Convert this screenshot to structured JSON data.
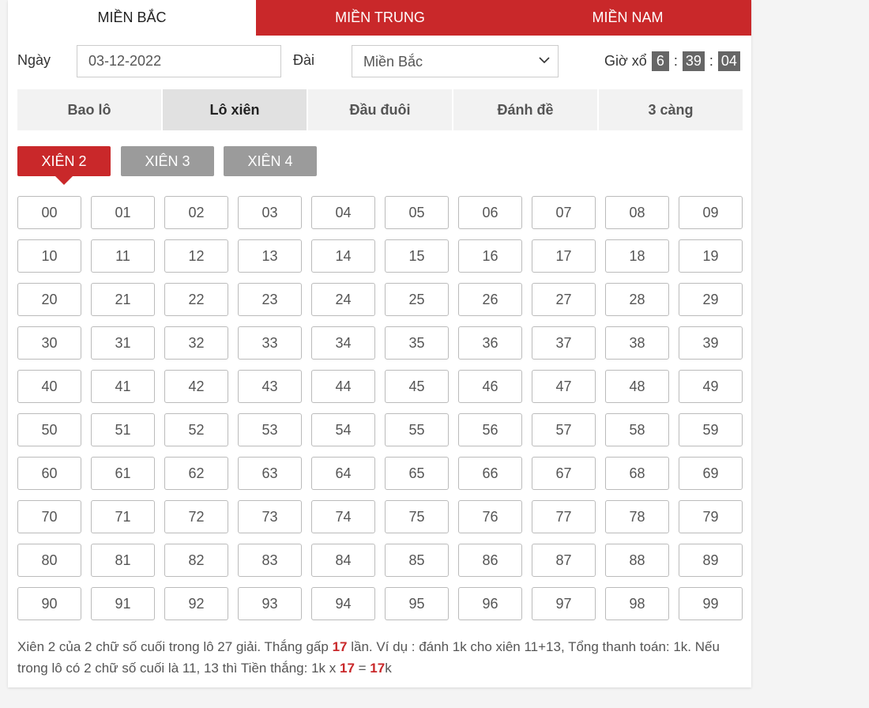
{
  "region_tabs": [
    {
      "label": "MIỀN BẮC",
      "active": true
    },
    {
      "label": "MIỀN TRUNG",
      "active": false
    },
    {
      "label": "MIỀN NAM",
      "active": false
    }
  ],
  "form": {
    "date_label": "Ngày",
    "date_value": "03-12-2022",
    "station_label": "Đài",
    "station_value": "Miền Bắc",
    "draw_time_label": "Giờ xổ",
    "hour": "6",
    "minute": "39",
    "second": "04",
    "separator": ":"
  },
  "game_tabs": [
    {
      "label": "Bao lô",
      "active": false
    },
    {
      "label": "Lô xiên",
      "active": true
    },
    {
      "label": "Đầu đuôi",
      "active": false
    },
    {
      "label": "Đánh đề",
      "active": false
    },
    {
      "label": "3 càng",
      "active": false
    }
  ],
  "xien_buttons": [
    {
      "label": "XIÊN 2",
      "active": true
    },
    {
      "label": "XIÊN 3",
      "active": false
    },
    {
      "label": "XIÊN 4",
      "active": false
    }
  ],
  "numbers": [
    "00",
    "01",
    "02",
    "03",
    "04",
    "05",
    "06",
    "07",
    "08",
    "09",
    "10",
    "11",
    "12",
    "13",
    "14",
    "15",
    "16",
    "17",
    "18",
    "19",
    "20",
    "21",
    "22",
    "23",
    "24",
    "25",
    "26",
    "27",
    "28",
    "29",
    "30",
    "31",
    "32",
    "33",
    "34",
    "35",
    "36",
    "37",
    "38",
    "39",
    "40",
    "41",
    "42",
    "43",
    "44",
    "45",
    "46",
    "47",
    "48",
    "49",
    "50",
    "51",
    "52",
    "53",
    "54",
    "55",
    "56",
    "57",
    "58",
    "59",
    "60",
    "61",
    "62",
    "63",
    "64",
    "65",
    "66",
    "67",
    "68",
    "69",
    "70",
    "71",
    "72",
    "73",
    "74",
    "75",
    "76",
    "77",
    "78",
    "79",
    "80",
    "81",
    "82",
    "83",
    "84",
    "85",
    "86",
    "87",
    "88",
    "89",
    "90",
    "91",
    "92",
    "93",
    "94",
    "95",
    "96",
    "97",
    "98",
    "99"
  ],
  "note": {
    "part1": "Xiên 2 của 2 chữ số cuối trong lô 27 giải. Thắng gấp ",
    "multiplier": "17",
    "part2": " lần. Ví dụ : đánh 1k cho xiên 11+13, Tổng thanh toán: 1k. Nếu trong lô có 2 chữ số cuối là 11, 13 thì Tiền thắng: 1k x ",
    "multiplier2": "17",
    "part3": " = ",
    "result": "17",
    "part4": "k"
  },
  "colors": {
    "accent": "#c9282a",
    "inactive_button": "#9b9b9b",
    "timer_box": "#666666"
  },
  "icons": {
    "select_arrow": "chevron-down-icon"
  }
}
